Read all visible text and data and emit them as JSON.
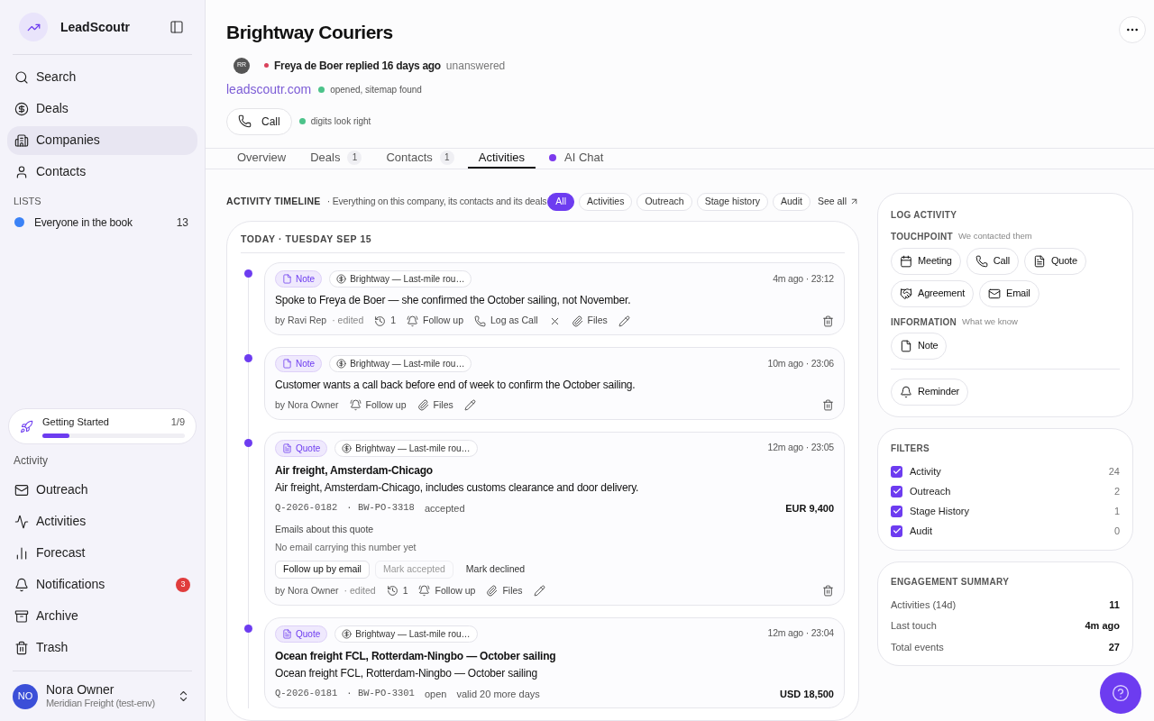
{
  "sidebar": {
    "app_name": "LeadScoutr",
    "nav": [
      {
        "label": "Search",
        "selected": false
      },
      {
        "label": "Deals",
        "selected": false
      },
      {
        "label": "Companies",
        "selected": true
      },
      {
        "label": "Contacts",
        "selected": false
      }
    ],
    "lists_heading": "LISTS",
    "lists": [
      {
        "label": "Everyone in the book",
        "count": "13",
        "color": "#3b82f6"
      }
    ],
    "getting_started": {
      "label": "Getting Started",
      "progress": "1/9",
      "level": 0.19
    },
    "activity_heading": "Activity",
    "activity_nav": [
      {
        "label": "Outreach"
      },
      {
        "label": "Activities"
      },
      {
        "label": "Forecast"
      },
      {
        "label": "Notifications",
        "badge": "3"
      },
      {
        "label": "Archive"
      },
      {
        "label": "Trash"
      }
    ],
    "user": {
      "initials": "NO",
      "name": "Nora Owner",
      "org": "Meridian Freight (test-env)"
    }
  },
  "header": {
    "title": "Brightway Couriers",
    "avatar": "RR",
    "reply": "Freya de Boer replied 16 days ago",
    "reply_state": "unanswered",
    "website": "leadscoutr.com",
    "website_status": "opened, sitemap found",
    "call_label": "Call",
    "phone_status": "digits look right"
  },
  "tabs": [
    {
      "label": "Overview",
      "selected": false
    },
    {
      "label": "Deals",
      "count": "1",
      "selected": false
    },
    {
      "label": "Contacts",
      "count": "1",
      "selected": false
    },
    {
      "label": "Activities",
      "selected": true
    },
    {
      "label": "AI Chat",
      "dot": true,
      "selected": false
    }
  ],
  "timeline": {
    "heading": "ACTIVITY TIMELINE",
    "subtitle": "· Everything on this company, its contacts and its deals",
    "filters": [
      {
        "label": "All",
        "selected": true
      },
      {
        "label": "Activities",
        "selected": false
      },
      {
        "label": "Outreach",
        "selected": false
      },
      {
        "label": "Stage history",
        "selected": false
      },
      {
        "label": "Audit",
        "selected": false
      }
    ],
    "see_all": "See all",
    "day": "TODAY · TUESDAY SEP 15",
    "items": [
      {
        "kind": "note",
        "tag": "Note",
        "deal": "Brightway — Last-mile rou…",
        "time": "4m ago · 23:12",
        "text": "Spoke to Freya de Boer — she confirmed the October sailing, not November.",
        "author": "by Ravi Rep",
        "edited": "· edited",
        "footer": [
          {
            "kind": "history",
            "label": "1"
          },
          {
            "kind": "follow_up",
            "label": "Follow up"
          },
          {
            "kind": "log_call",
            "label": "Log as Call"
          },
          {
            "kind": "dismiss"
          },
          {
            "kind": "files",
            "label": "Files"
          },
          {
            "kind": "edit"
          }
        ]
      },
      {
        "kind": "note",
        "tag": "Note",
        "deal": "Brightway — Last-mile rou…",
        "time": "10m ago · 23:06",
        "text": "Customer wants a call back before end of week to confirm the October sailing.",
        "author": "by Nora Owner",
        "footer": [
          {
            "kind": "follow_up",
            "label": "Follow up"
          },
          {
            "kind": "files",
            "label": "Files"
          },
          {
            "kind": "edit"
          }
        ]
      },
      {
        "kind": "quote",
        "tag": "Quote",
        "deal": "Brightway — Last-mile rou…",
        "time": "12m ago · 23:05",
        "title": "Air freight, Amsterdam-Chicago",
        "text": "Air freight, Amsterdam-Chicago, includes customs clearance and door delivery.",
        "quote_number": "Q-2026-0182",
        "po_number": "· BW-PO-3318",
        "status": "accepted",
        "amount": "EUR 9,400",
        "emails_heading": "Emails about this quote",
        "emails_empty": "No email carrying this number yet",
        "actions": [
          {
            "label": "Follow up by email",
            "kind": "outline",
            "disabled": false
          },
          {
            "label": "Mark accepted",
            "kind": "outline",
            "disabled": true
          },
          {
            "label": "Mark declined",
            "kind": "ghost",
            "disabled": false
          }
        ],
        "author": "by Nora Owner",
        "edited": "· edited",
        "footer": [
          {
            "kind": "history",
            "label": "1"
          },
          {
            "kind": "follow_up",
            "label": "Follow up"
          },
          {
            "kind": "files",
            "label": "Files"
          },
          {
            "kind": "edit"
          }
        ]
      },
      {
        "kind": "quote",
        "tag": "Quote",
        "deal": "Brightway — Last-mile rou…",
        "time": "12m ago · 23:04",
        "title": "Ocean freight FCL, Rotterdam-Ningbo — October sailing",
        "text": "Ocean freight FCL, Rotterdam-Ningbo — October sailing",
        "quote_number": "Q-2026-0181",
        "po_number": "· BW-PO-3301",
        "status": "open",
        "validity": "valid 20 more days",
        "amount": "USD 18,500"
      }
    ]
  },
  "log_activity": {
    "heading": "LOG ACTIVITY",
    "touchpoint_heading": "TOUCHPOINT",
    "touchpoint_hint": "We contacted them",
    "touchpoints": [
      "Meeting",
      "Call",
      "Quote",
      "Agreement",
      "Email"
    ],
    "information_heading": "INFORMATION",
    "information_hint": "What we know",
    "information": [
      "Note"
    ],
    "reminder": "Reminder"
  },
  "filters": {
    "heading": "FILTERS",
    "items": [
      {
        "label": "Activity",
        "count": "24",
        "checked": true
      },
      {
        "label": "Outreach",
        "count": "2",
        "checked": true
      },
      {
        "label": "Stage History",
        "count": "1",
        "checked": true
      },
      {
        "label": "Audit",
        "count": "0",
        "checked": true
      }
    ]
  },
  "engagement": {
    "heading": "ENGAGEMENT SUMMARY",
    "rows": [
      {
        "label": "Activities (14d)",
        "value": "11"
      },
      {
        "label": "Last touch",
        "value": "4m ago"
      },
      {
        "label": "Total events",
        "value": "27"
      }
    ]
  }
}
